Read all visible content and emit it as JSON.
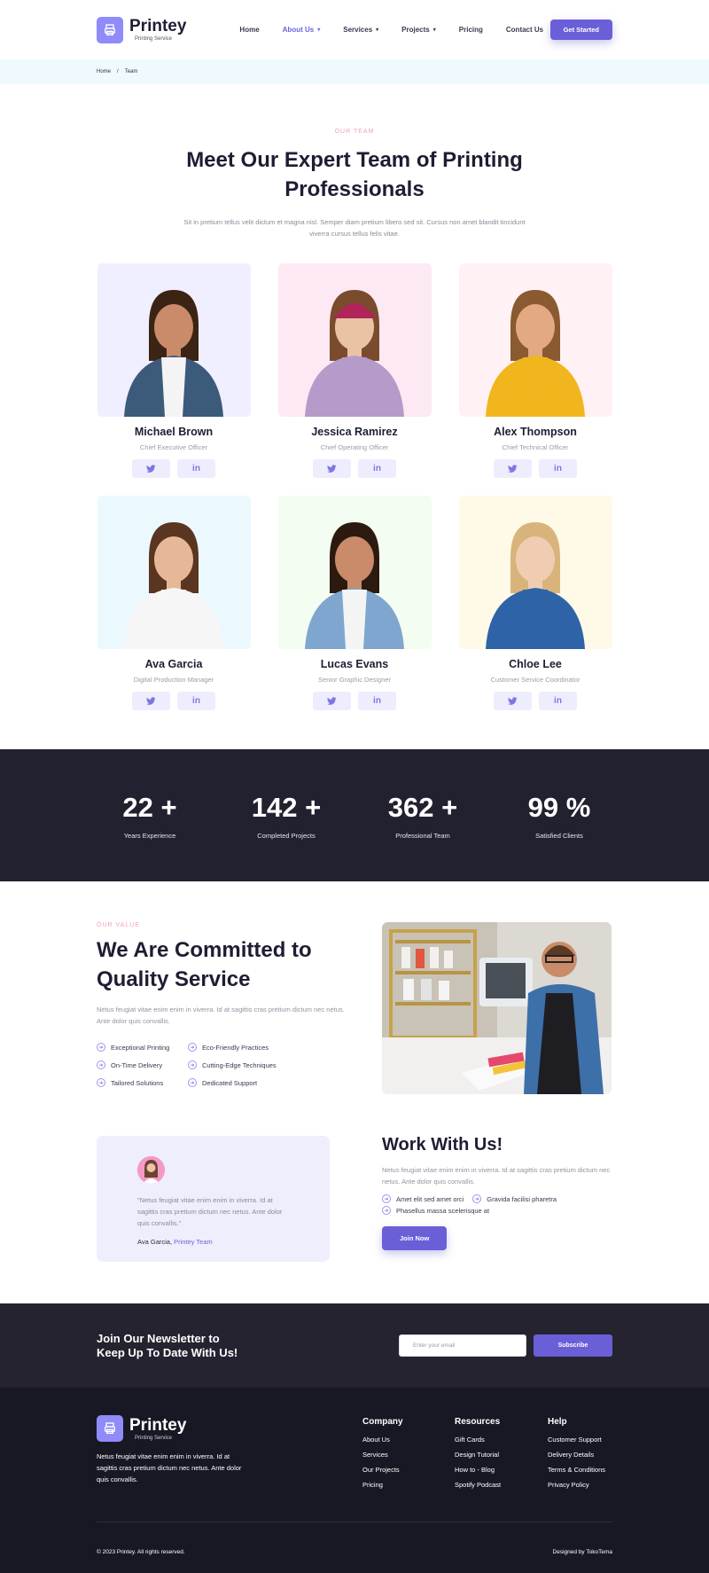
{
  "header": {
    "logo_name": "Printey",
    "logo_sub": "Printing Service",
    "nav": [
      {
        "label": "Home",
        "dropdown": false,
        "active": false
      },
      {
        "label": "About Us",
        "dropdown": true,
        "active": true
      },
      {
        "label": "Services",
        "dropdown": true,
        "active": false
      },
      {
        "label": "Projects",
        "dropdown": true,
        "active": false
      },
      {
        "label": "Pricing",
        "dropdown": false,
        "active": false
      },
      {
        "label": "Contact Us",
        "dropdown": false,
        "active": false
      }
    ],
    "cta": "Get Started"
  },
  "breadcrumb": {
    "home": "Home",
    "sep": "/",
    "current": "Team"
  },
  "team": {
    "eyebrow": "OUR TEAM",
    "title_line1": "Meet Our Expert Team of Printing",
    "title_line2": "Professionals",
    "lead": "Sit in pretium tellus velit dictum et magna nisl. Semper diam pretium libero sed sit. Cursus non amet blandit tincidunt viverra cursus tellus felis vitae.",
    "members": [
      {
        "name": "Michael Brown",
        "role": "Chief Executive Officer",
        "bg": "#f0efff"
      },
      {
        "name": "Jessica Ramirez",
        "role": "Chief Operating Officer",
        "bg": "#fde9f4"
      },
      {
        "name": "Alex Thompson",
        "role": "Chief Technical Officer",
        "bg": "#fff1f4"
      },
      {
        "name": "Ava Garcia",
        "role": "Digital Production Manager",
        "bg": "#ebf8fd"
      },
      {
        "name": "Lucas Evans",
        "role": "Senior Graphic Designer",
        "bg": "#f3fdf1"
      },
      {
        "name": "Chloe Lee",
        "role": "Customer Service Coordinator",
        "bg": "#fff9e7"
      }
    ],
    "social": {
      "twitter": "twitter-icon",
      "linkedin": "linkedin-icon",
      "linkedin_label": "in"
    }
  },
  "stats": [
    {
      "num": "22 +",
      "label": "Years Experience"
    },
    {
      "num": "142 +",
      "label": "Completed Projects"
    },
    {
      "num": "362 +",
      "label": "Professional Team"
    },
    {
      "num": "99 %",
      "label": "Satisfied Clients"
    }
  ],
  "value": {
    "eyebrow": "OUR VALUE",
    "title": "We Are Committed to Quality Service",
    "para": "Netus feugiat vitae enim enim in viverra. Id at sagittis cras pretium dictum nec netus. Ante dolor quis convallis.",
    "features": [
      "Exceptional Printing",
      "Eco-Friendly Practices",
      "On-Time Delivery",
      "Cutting-Edge Techniques",
      "Tailored Solutions",
      "Dedicated Support"
    ]
  },
  "testimonial": {
    "quote": "\"Netus feugiat vitae enim enim in viverra. Id at sagittis cras pretium dictum nec netus. Ante dolor quis convallis.\"",
    "author": "Ava Garcia,",
    "team": "Printey Team"
  },
  "work": {
    "title": "Work With Us!",
    "para": "Netus feugiat vitae enim enim in viverra. Id at sagittis cras pretium dictum nec netus. Ante dolor quis convallis.",
    "points": [
      "Amet elit sed amet orci",
      "Gravida facilisi pharetra",
      "Phasellus massa scelerisque at"
    ],
    "cta": "Join Now"
  },
  "newsletter": {
    "title": "Join Our Newsletter to Keep Up To Date With Us!",
    "placeholder": "Enter your email",
    "cta": "Subscribe"
  },
  "footer": {
    "logo_name": "Printey",
    "logo_sub": "Printing Service",
    "desc": "Netus feugiat vitae enim enim in viverra. Id at sagittis cras pretium dictum nec netus. Ante dolor quis convallis.",
    "cols": [
      {
        "title": "Company",
        "links": [
          "About Us",
          "Services",
          "Our Projects",
          "Pricing"
        ]
      },
      {
        "title": "Resources",
        "links": [
          "Gift Cards",
          "Design Tutorial",
          "How to - Blog",
          "Spotify Podcast"
        ]
      },
      {
        "title": "Help",
        "links": [
          "Customer Support",
          "Delivery Details",
          "Terms & Conditions",
          "Privacy Policy"
        ]
      }
    ],
    "copyright": "© 2023 Printey. All rights reserved.",
    "designed": "Designed by TokoTema"
  },
  "colors": {
    "accent": "#6a5fd7",
    "pink": "#f29cc8",
    "dark": "#22212f"
  }
}
